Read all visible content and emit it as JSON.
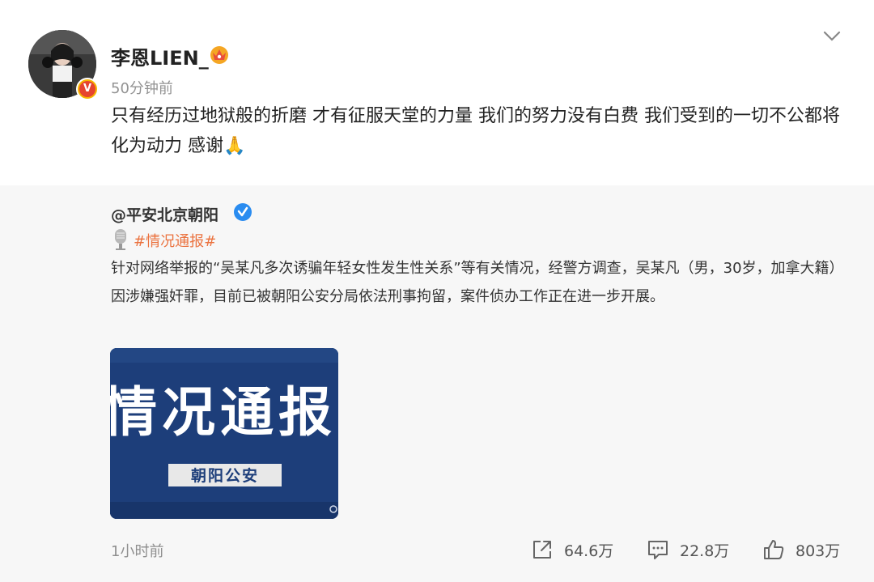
{
  "post": {
    "username": "李恩LIEN_",
    "time": "50分钟前",
    "text": "只有经历过地狱般的折磨 才有征服天堂的力量 我们的努力没有白费 我们受到的一切不公都将化为动力 感谢🙏",
    "verified_badge": "V"
  },
  "repost": {
    "username": "@平安北京朝阳",
    "hashtag": "#情况通报#",
    "text": "针对网络举报的“吴某凡多次诱骗年轻女性发生性关系”等有关情况，经警方调查，吴某凡（男，30岁，加拿大籍）因涉嫌强奸罪，目前已被朝阳公安分局依法刑事拘留，案件侦办工作正在进一步开展。",
    "image": {
      "title": "情况通报",
      "subtitle": "朝阳公安"
    },
    "time": "1小时前",
    "actions": {
      "share": "64.6万",
      "comment": "22.8万",
      "like": "803万"
    }
  },
  "colors": {
    "accent_orange": "#eb7340",
    "verified_blue": "#2a8cf0",
    "thumb_blue": "#1d3e7a"
  },
  "icons": [
    "chevron-down-icon",
    "crown-badge-icon",
    "verified-icon",
    "microphone-icon",
    "share-icon",
    "comment-icon",
    "like-icon"
  ]
}
